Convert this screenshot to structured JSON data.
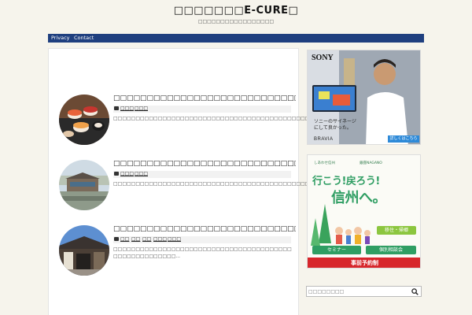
{
  "header": {
    "title": "□□□□□□□E-CURE□",
    "description": "□□□□□□□□□□□□□□□□□"
  },
  "nav": {
    "items": [
      {
        "label": "Privacy"
      },
      {
        "label": "Contact"
      }
    ]
  },
  "posts": [
    {
      "title": "□□□□□□□□□□□□□□□□□□□□□□□□□□□□□",
      "categories": [
        "□□□",
        "□□□"
      ],
      "excerpt": "□□□□□□□□□□□□□□□□□□□□□□□□□□□□□□□□□□□□□□□□□□□□□□□□□□□□□□□□..."
    },
    {
      "title": "□□□□□□□□□□□□□□□□□□□□□□□□□□□□□",
      "categories": [
        "□□□",
        "□□□"
      ],
      "excerpt": "□□□□□□□□□□□□□□□□□□□□□□□□□□□□□□□□□□□□□□□□□□□□□□□□□□□□□□□□..."
    },
    {
      "title": "□□□□□□□□□□□□□□□□□□□□□□□□□□□□□",
      "categories": [
        "□□",
        "□□",
        "□□",
        "□□□",
        "□□□"
      ],
      "excerpt": "□□□□□□□□□□□□□□□□□□□□□□□□□□□□□□□□□□□□□□□□ □□□□□□□□□□□□□□..."
    }
  ],
  "ads": {
    "sony": {
      "brand": "SONY",
      "caption_line1": "ソニーのサイネージ",
      "caption_line2": "にして良かった。",
      "product": "BRAVIA",
      "cta": "詳しくはこちら"
    },
    "shinshu": {
      "org_left": "しあわせ信州",
      "org_right": "銀座NAGANO",
      "headline1": "行こう!戻ろう!",
      "headline2": "信州へ。",
      "badge": "移住・帰郷",
      "btn_seminar": "セミナー",
      "btn_consult": "個別相談会",
      "banner": "事前予約制"
    }
  },
  "search": {
    "placeholder": "□□□□□□□□"
  },
  "colors": {
    "nav_bg": "#1f3f7f",
    "page_bg": "#f6f4ec",
    "shinshu_green": "#2f9e63",
    "shinshu_red": "#d7262b"
  }
}
